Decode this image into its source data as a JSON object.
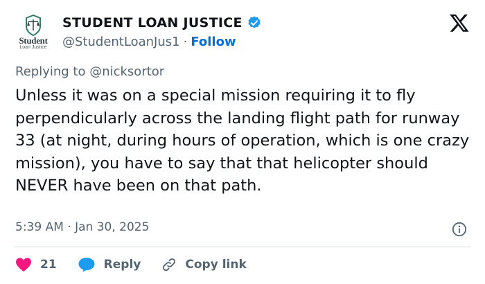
{
  "author": {
    "display_name": "STUDENT LOAN JUSTICE",
    "handle": "@StudentLoanJus1",
    "separator": "·",
    "follow_label": "Follow",
    "avatar_word": "Student",
    "avatar_sub": "Loan Justice"
  },
  "reply_to": "Replying to @nicksortor",
  "tweet_text": "Unless it was on a special mission requiring it to fly perpendicularly across the landing flight path for runway 33 (at night, during hours of operation, which is one crazy mission), you have to say that that helicopter should NEVER have been on that path.",
  "timestamp": "5:39 AM · Jan 30, 2025",
  "actions": {
    "likes": "21",
    "reply_label": "Reply",
    "copy_link_label": "Copy link"
  },
  "colors": {
    "verified": "#1d9bf0",
    "like": "#f91880",
    "reply": "#1d9bf0",
    "follow": "#006fd6"
  },
  "icons": [
    "verified-badge-icon",
    "x-logo-icon",
    "info-icon",
    "heart-icon",
    "reply-bubble-icon",
    "link-icon"
  ]
}
